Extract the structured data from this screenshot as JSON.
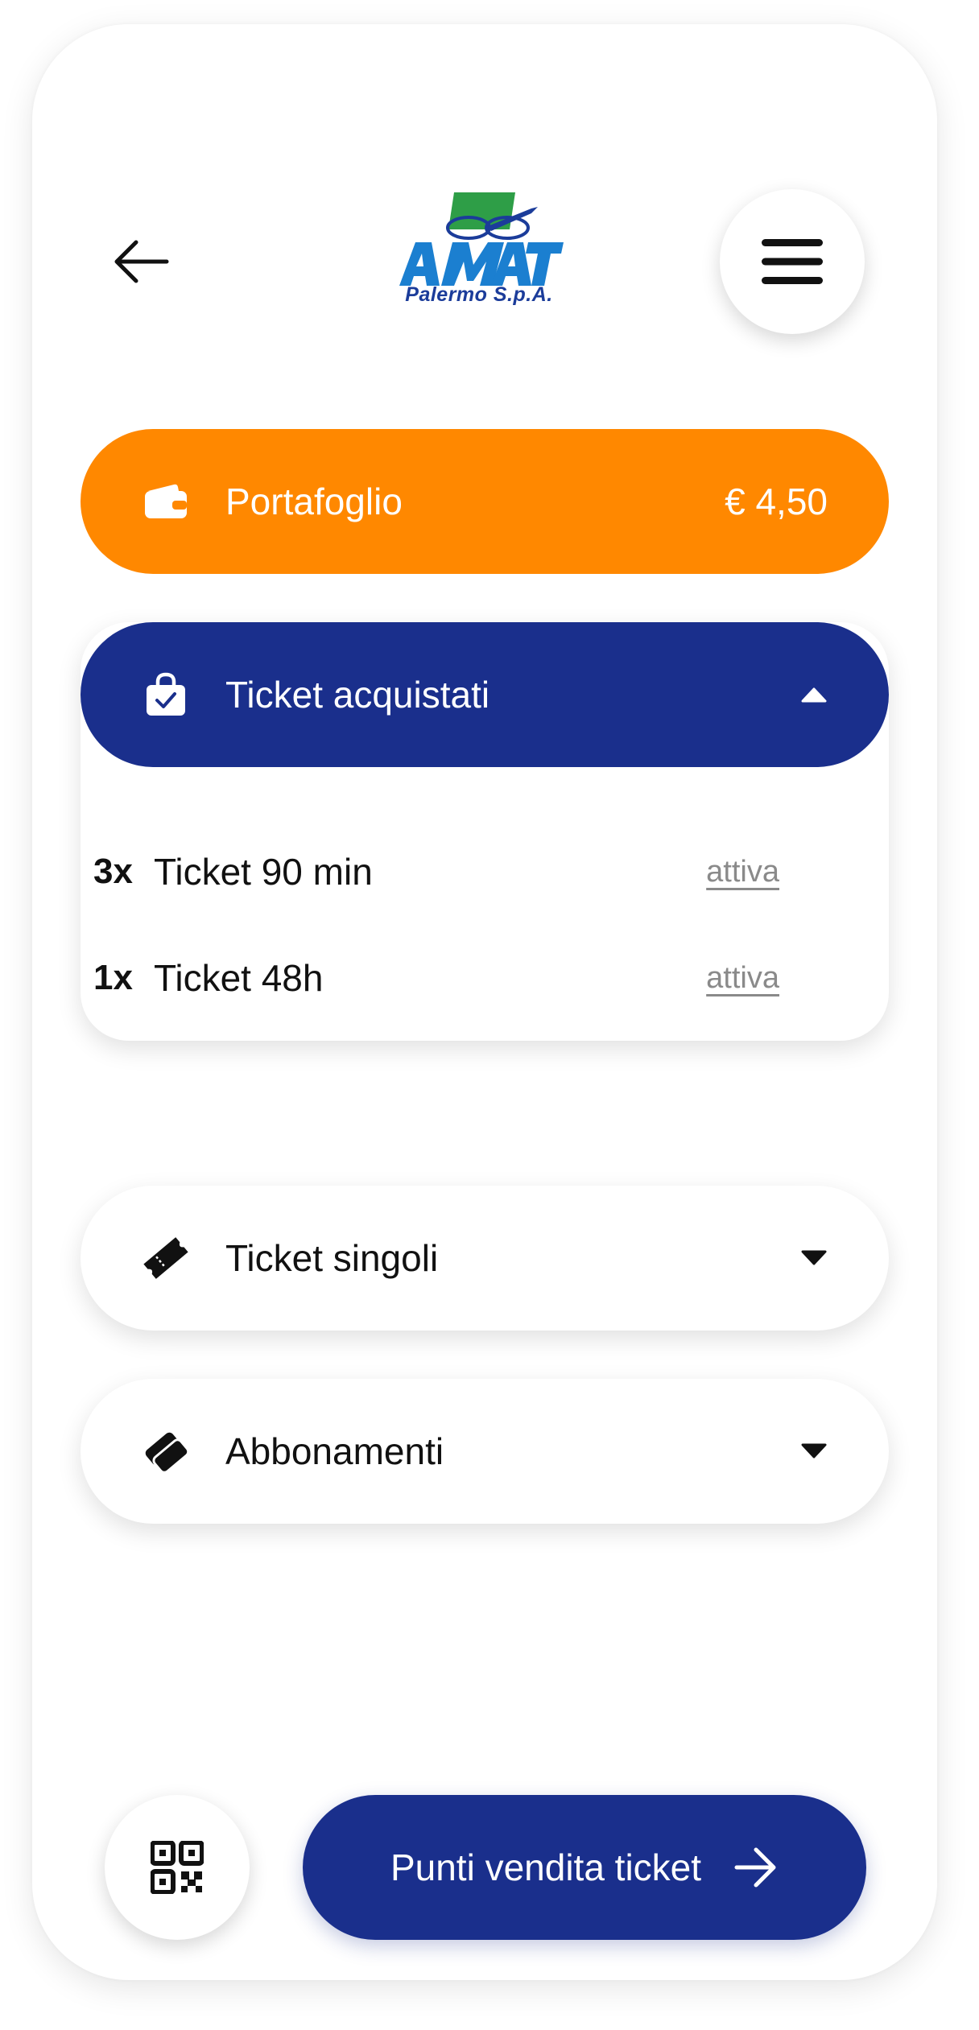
{
  "header": {
    "back_icon": "arrow-left-icon",
    "menu_icon": "hamburger-menu-icon",
    "logo": {
      "wordmark": "AMAT",
      "subtitle": "Palermo S.p.A."
    }
  },
  "wallet": {
    "icon": "wallet-icon",
    "label": "Portafoglio",
    "balance": "€ 4,50",
    "color": "#FF8800"
  },
  "purchased": {
    "icon": "shopping-bag-check-icon",
    "label": "Ticket acquistati",
    "expanded": true,
    "color": "#1A2F8C",
    "items": [
      {
        "qty": "3x",
        "name": "Ticket 90 min",
        "action": "attiva"
      },
      {
        "qty": "1x",
        "name": "Ticket 48h",
        "action": "attiva"
      }
    ]
  },
  "singles": {
    "icon": "ticket-icon",
    "label": "Ticket singoli",
    "expanded": false
  },
  "subscriptions": {
    "icon": "card-stack-icon",
    "label": "Abbonamenti",
    "expanded": false
  },
  "bottom": {
    "qr_icon": "qr-code-icon",
    "cta_label": "Punti vendita ticket",
    "cta_icon": "arrow-right-icon"
  }
}
